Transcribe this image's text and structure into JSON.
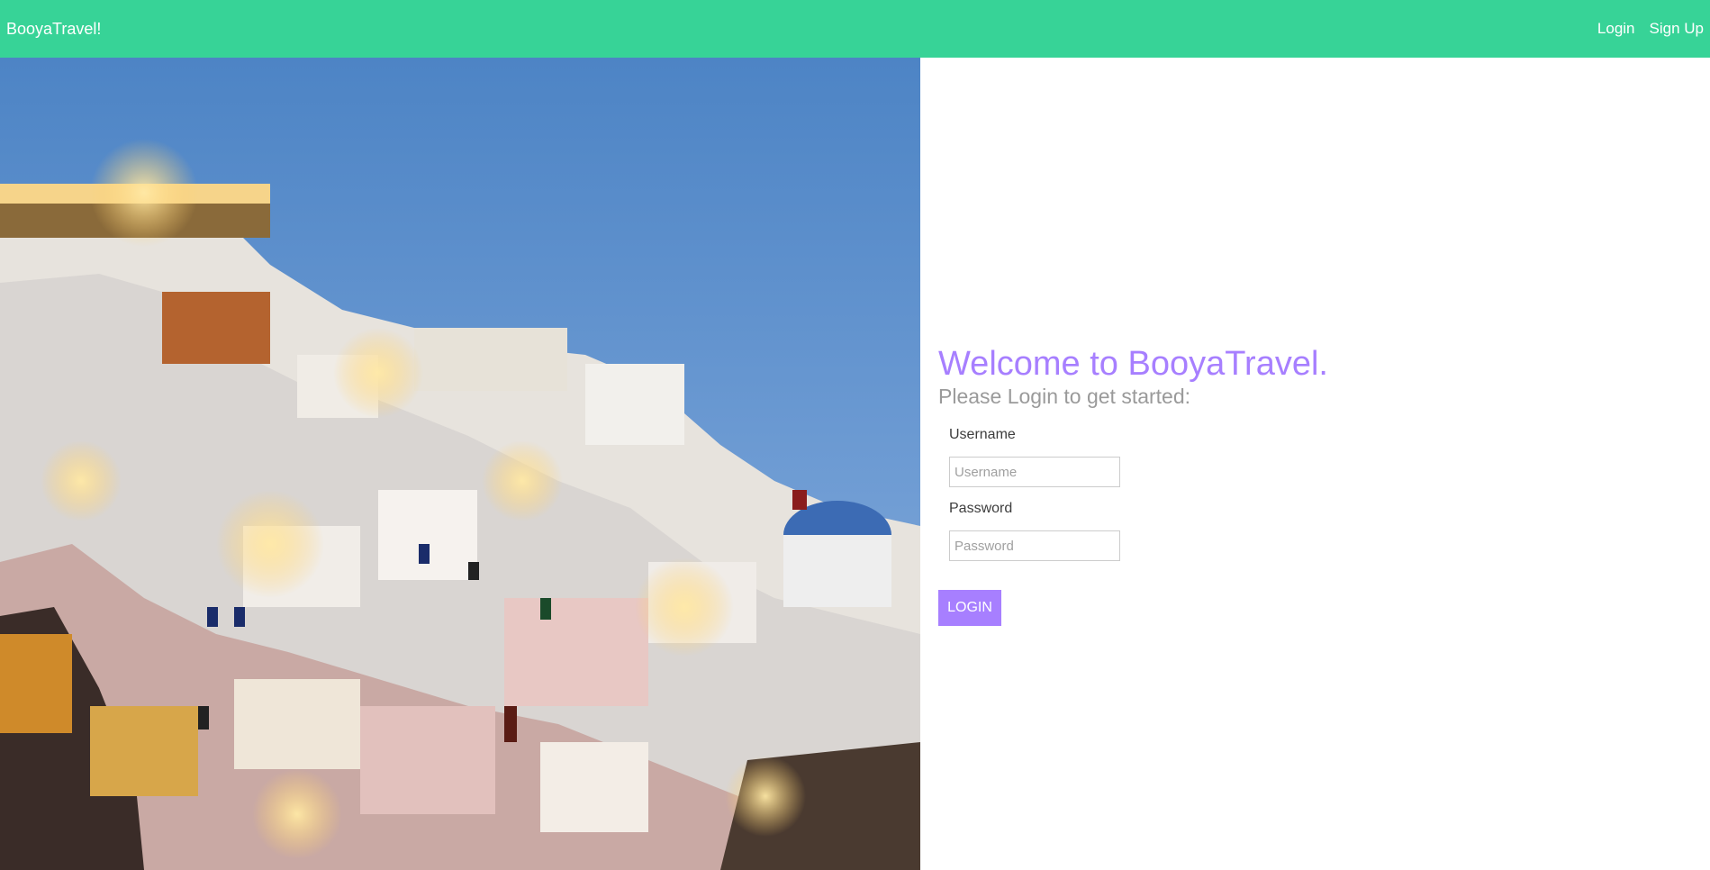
{
  "nav": {
    "brand": "BooyaTravel!",
    "links": [
      {
        "label": "Login"
      },
      {
        "label": "Sign Up"
      }
    ],
    "color": "#37d397"
  },
  "login": {
    "welcome": "Welcome to BooyaTravel.",
    "subtitle": "Please Login to get started:",
    "username": {
      "label": "Username",
      "placeholder": "Username",
      "value": ""
    },
    "password": {
      "label": "Password",
      "placeholder": "Password",
      "value": ""
    },
    "button": "LOGIN",
    "accent": "#a77fff"
  },
  "hero": {
    "icon": "santorini-photo"
  }
}
